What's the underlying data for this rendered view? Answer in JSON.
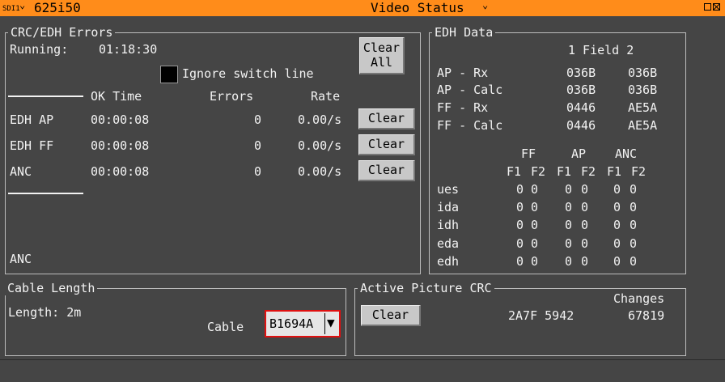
{
  "titlebar": {
    "input": "SDI1",
    "format": "625i50",
    "title": "Video Status"
  },
  "crc_edh": {
    "legend": "CRC/EDH Errors",
    "running_label": "Running:",
    "running_value": "01:18:30",
    "clear_all_line1": "Clear",
    "clear_all_line2": "All",
    "ignore_switch_label": "Ignore switch line",
    "headers": {
      "ok_time": "OK Time",
      "errors": "Errors",
      "rate": "Rate"
    },
    "rows": [
      {
        "name": "EDH AP",
        "ok_time": "00:00:08",
        "errors": "0",
        "rate": "0.00/s",
        "clear": "Clear"
      },
      {
        "name": "EDH FF",
        "ok_time": "00:00:08",
        "errors": "0",
        "rate": "0.00/s",
        "clear": "Clear"
      },
      {
        "name": "ANC",
        "ok_time": "00:00:08",
        "errors": "0",
        "rate": "0.00/s",
        "clear": "Clear"
      }
    ],
    "footer_label": "ANC"
  },
  "edh_data": {
    "legend": "EDH Data",
    "field_header": "1 Field 2",
    "rows": [
      {
        "label": "AP - Rx",
        "f1": "036B",
        "f2": "036B"
      },
      {
        "label": "AP - Calc",
        "f1": "036B",
        "f2": "036B"
      },
      {
        "label": "FF - Rx",
        "f1": "0446",
        "f2": "AE5A"
      },
      {
        "label": "FF - Calc",
        "f1": "0446",
        "f2": "AE5A"
      }
    ],
    "group_headers": [
      "FF",
      "AP",
      "ANC"
    ],
    "field_headers": [
      "F1",
      "F2",
      "F1",
      "F2",
      "F1",
      "F2"
    ],
    "flags": [
      {
        "label": "ues",
        "values": [
          "0",
          "0",
          "0",
          "0",
          "0",
          "0"
        ]
      },
      {
        "label": "ida",
        "values": [
          "0",
          "0",
          "0",
          "0",
          "0",
          "0"
        ]
      },
      {
        "label": "idh",
        "values": [
          "0",
          "0",
          "0",
          "0",
          "0",
          "0"
        ]
      },
      {
        "label": "eda",
        "values": [
          "0",
          "0",
          "0",
          "0",
          "0",
          "0"
        ]
      },
      {
        "label": "edh",
        "values": [
          "0",
          "0",
          "0",
          "0",
          "0",
          "0"
        ]
      }
    ]
  },
  "cable": {
    "legend": "Cable Length",
    "length_text": "Length: 2m",
    "cable_label": "Cable",
    "cable_value": "B1694A"
  },
  "apcrc": {
    "legend": "Active Picture CRC",
    "clear": "Clear",
    "changes_label": "Changes",
    "crc_value": "2A7F 5942",
    "changes_value": "67819"
  }
}
